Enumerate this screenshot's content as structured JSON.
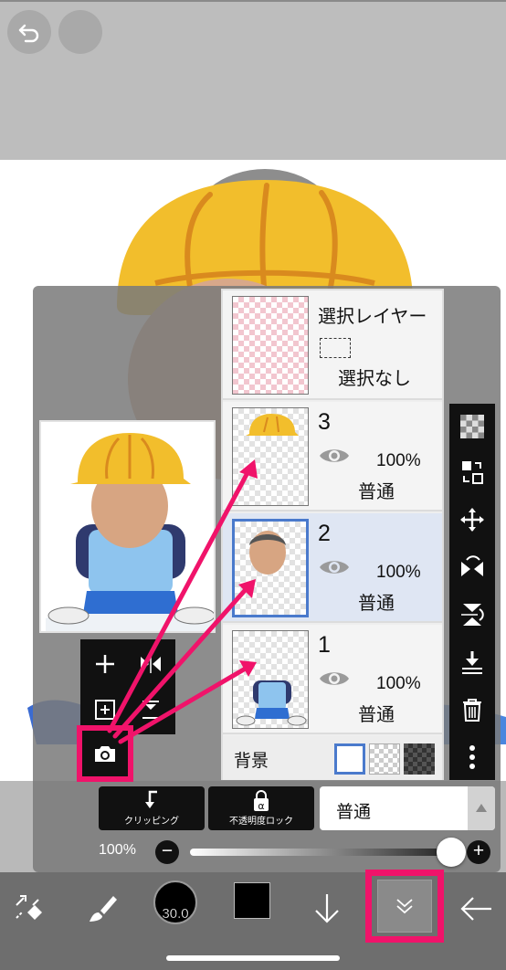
{
  "layers_panel": {
    "selection_layer": {
      "title": "選択レイヤー",
      "status": "選択なし"
    },
    "layers": [
      {
        "number": "3",
        "opacity": "100%",
        "blend": "普通"
      },
      {
        "number": "2",
        "opacity": "100%",
        "blend": "普通"
      },
      {
        "number": "1",
        "opacity": "100%",
        "blend": "普通"
      }
    ],
    "background_label": "背景"
  },
  "controls": {
    "clipping_label": "クリッピング",
    "alpha_lock_label": "不透明度ロック",
    "alpha_icon_glyph": "α",
    "blend_mode": "普通",
    "opacity_label": "100%",
    "opacity_value": 1.0,
    "minus": "−",
    "plus": "+"
  },
  "bottom_toolbar": {
    "brush_size": "30.0",
    "color": "#000000"
  },
  "colors": {
    "highlight": "#f0136a",
    "selected_layer_border": "#4a7acc",
    "helmet": "#f2be2c"
  }
}
